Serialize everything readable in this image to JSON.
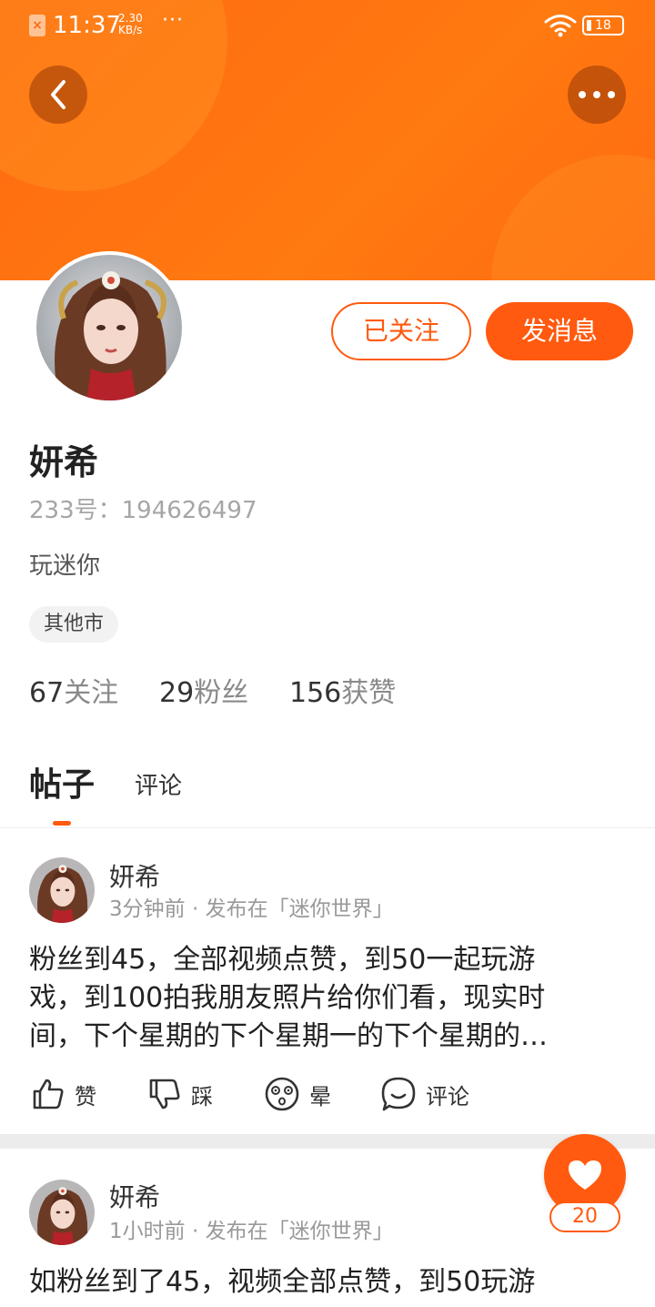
{
  "status_bar": {
    "time": "11:37",
    "net_speed": "2.30 KB/s",
    "more": "···",
    "battery": "18"
  },
  "profile": {
    "name": "妍希",
    "uid": "233号：194626497",
    "bio": "玩迷你",
    "location_tag": "其他市",
    "follow_button": "已关注",
    "message_button": "发消息",
    "stats": [
      {
        "num": "67",
        "label": "关注"
      },
      {
        "num": "29",
        "label": "粉丝"
      },
      {
        "num": "156",
        "label": "获赞"
      }
    ]
  },
  "tabs": {
    "posts": "帖子",
    "comments": "评论"
  },
  "posts": [
    {
      "author": "妍希",
      "meta": "3分钟前 · 发布在「迷你世界」",
      "lines": [
        "粉丝到45，全部视频点赞，到50一起玩游",
        "戏，到100拍我朋友照片给你们看，现实时",
        "间，下个星期的下个星期一的下个星期的…"
      ],
      "actions": {
        "like": "赞",
        "dislike": "踩",
        "dizzy": "晕",
        "comment": "评论"
      }
    },
    {
      "author": "妍希",
      "meta": "1小时前 · 发布在「迷你世界」",
      "lines": [
        "如粉丝到了45，视频全部点赞，到50玩游"
      ]
    }
  ],
  "floating_like": {
    "count": "20"
  },
  "colors": {
    "accent": "#ff5a0f",
    "header": "#ff7a10"
  }
}
